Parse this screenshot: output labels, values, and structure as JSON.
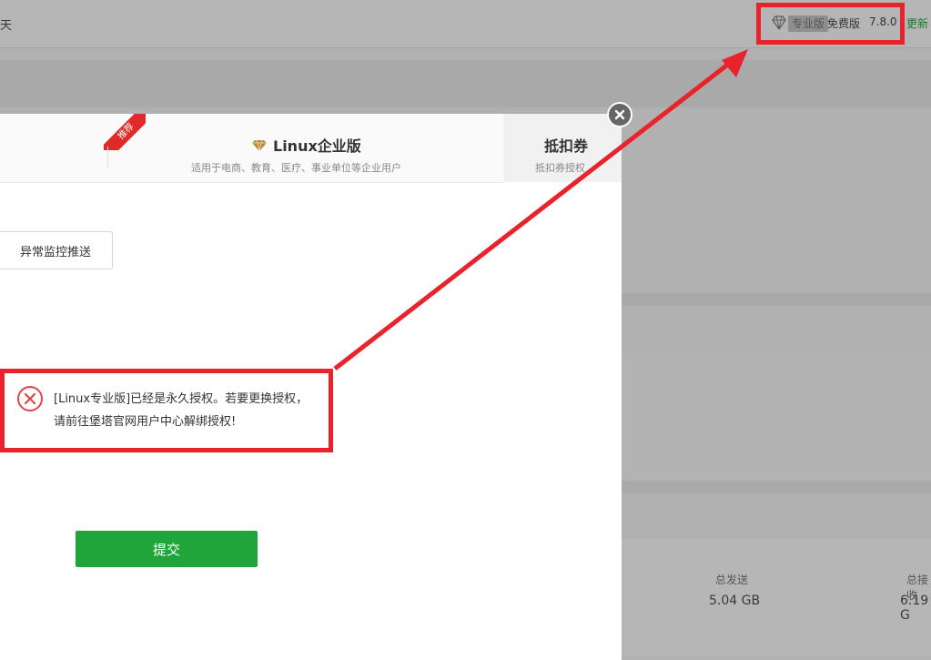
{
  "background": {
    "fragment": "天",
    "pro_badge": "专业版",
    "free_label": "免费版",
    "version": "7.8.0",
    "update_link": "更新",
    "stats": [
      {
        "label": "总发送",
        "value": "5.04 GB"
      },
      {
        "label": "总接收",
        "value": "6.19 G"
      }
    ]
  },
  "modal": {
    "ribbon": "推荐",
    "tab_enterprise_title": "Linux企业版",
    "tab_enterprise_desc": "适用于电商、教育、医疗、事业单位等企业用户",
    "tab_voucher_title": "抵扣券",
    "tab_voucher_desc": "抵扣券授权",
    "monitor_label": "异常监控推送",
    "error_message": "[Linux专业版]已经是永久授权。若要更换授权，请前往堡塔官网用户中心解绑授权!",
    "submit_label": "提交"
  },
  "colors": {
    "accent_green": "#20a53a",
    "annotation_red": "#e8232b",
    "ribbon_red": "#e02a2a",
    "error_red": "#e0464b"
  }
}
